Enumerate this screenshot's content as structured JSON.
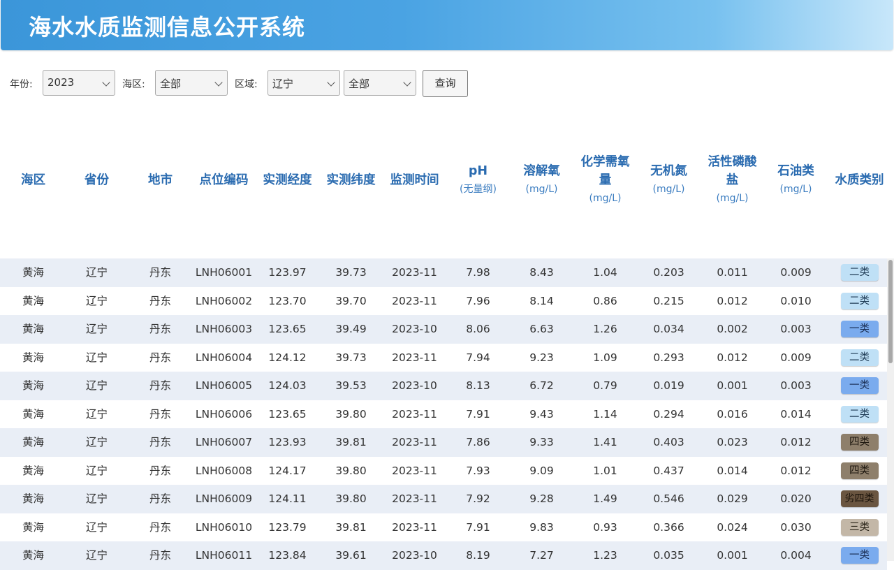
{
  "app": {
    "title": "海水水质监测信息公开系统"
  },
  "filters": {
    "year_label": "年份:",
    "year_value": "2023",
    "sea_label": "海区:",
    "sea_value": "全部",
    "region_label": "区域:",
    "region_value": "辽宁",
    "subregion_value": "全部",
    "query_button": "查询"
  },
  "columns": [
    {
      "label": "海区",
      "unit": ""
    },
    {
      "label": "省份",
      "unit": ""
    },
    {
      "label": "地市",
      "unit": ""
    },
    {
      "label": "点位编码",
      "unit": ""
    },
    {
      "label": "实测经度",
      "unit": ""
    },
    {
      "label": "实测纬度",
      "unit": ""
    },
    {
      "label": "监测时间",
      "unit": ""
    },
    {
      "label": "pH",
      "unit": "(无量纲)"
    },
    {
      "label": "溶解氧",
      "unit": "(mg/L)"
    },
    {
      "label": "化学需氧量",
      "unit": "(mg/L)"
    },
    {
      "label": "无机氮",
      "unit": "(mg/L)"
    },
    {
      "label": "活性磷酸盐",
      "unit": "(mg/L)"
    },
    {
      "label": "石油类",
      "unit": "(mg/L)"
    },
    {
      "label": "水质类别",
      "unit": ""
    }
  ],
  "grade_colors": {
    "一类": {
      "bg": "#7aabee",
      "fg": "#1b2f55"
    },
    "二类": {
      "bg": "#bfe0f6",
      "fg": "#1f3b55"
    },
    "三类": {
      "bg": "#c3b7a7",
      "fg": "#2a2418"
    },
    "四类": {
      "bg": "#8e7f6b",
      "fg": "#1d170f"
    },
    "劣四类": {
      "bg": "#6a5540",
      "fg": "#1a120a"
    }
  },
  "rows": [
    [
      "黄海",
      "辽宁",
      "丹东",
      "LNH06001",
      "123.97",
      "39.73",
      "2023-11",
      "7.98",
      "8.43",
      "1.04",
      "0.203",
      "0.011",
      "0.009",
      "二类"
    ],
    [
      "黄海",
      "辽宁",
      "丹东",
      "LNH06002",
      "123.70",
      "39.70",
      "2023-11",
      "7.96",
      "8.14",
      "0.86",
      "0.215",
      "0.012",
      "0.010",
      "二类"
    ],
    [
      "黄海",
      "辽宁",
      "丹东",
      "LNH06003",
      "123.65",
      "39.49",
      "2023-10",
      "8.06",
      "6.63",
      "1.26",
      "0.034",
      "0.002",
      "0.003",
      "一类"
    ],
    [
      "黄海",
      "辽宁",
      "丹东",
      "LNH06004",
      "124.12",
      "39.73",
      "2023-11",
      "7.94",
      "9.23",
      "1.09",
      "0.293",
      "0.012",
      "0.009",
      "二类"
    ],
    [
      "黄海",
      "辽宁",
      "丹东",
      "LNH06005",
      "124.03",
      "39.53",
      "2023-10",
      "8.13",
      "6.72",
      "0.79",
      "0.019",
      "0.001",
      "0.003",
      "一类"
    ],
    [
      "黄海",
      "辽宁",
      "丹东",
      "LNH06006",
      "123.65",
      "39.80",
      "2023-11",
      "7.91",
      "9.43",
      "1.14",
      "0.294",
      "0.016",
      "0.014",
      "二类"
    ],
    [
      "黄海",
      "辽宁",
      "丹东",
      "LNH06007",
      "123.93",
      "39.81",
      "2023-11",
      "7.86",
      "9.33",
      "1.41",
      "0.403",
      "0.023",
      "0.012",
      "四类"
    ],
    [
      "黄海",
      "辽宁",
      "丹东",
      "LNH06008",
      "124.17",
      "39.80",
      "2023-11",
      "7.93",
      "9.09",
      "1.01",
      "0.437",
      "0.014",
      "0.012",
      "四类"
    ],
    [
      "黄海",
      "辽宁",
      "丹东",
      "LNH06009",
      "124.11",
      "39.80",
      "2023-11",
      "7.92",
      "9.28",
      "1.49",
      "0.546",
      "0.029",
      "0.020",
      "劣四类"
    ],
    [
      "黄海",
      "辽宁",
      "丹东",
      "LNH06010",
      "123.79",
      "39.81",
      "2023-11",
      "7.91",
      "9.83",
      "0.93",
      "0.366",
      "0.024",
      "0.030",
      "三类"
    ],
    [
      "黄海",
      "辽宁",
      "丹东",
      "LNH06011",
      "123.84",
      "39.61",
      "2023-10",
      "8.19",
      "7.27",
      "1.23",
      "0.035",
      "0.001",
      "0.004",
      "一类"
    ]
  ]
}
